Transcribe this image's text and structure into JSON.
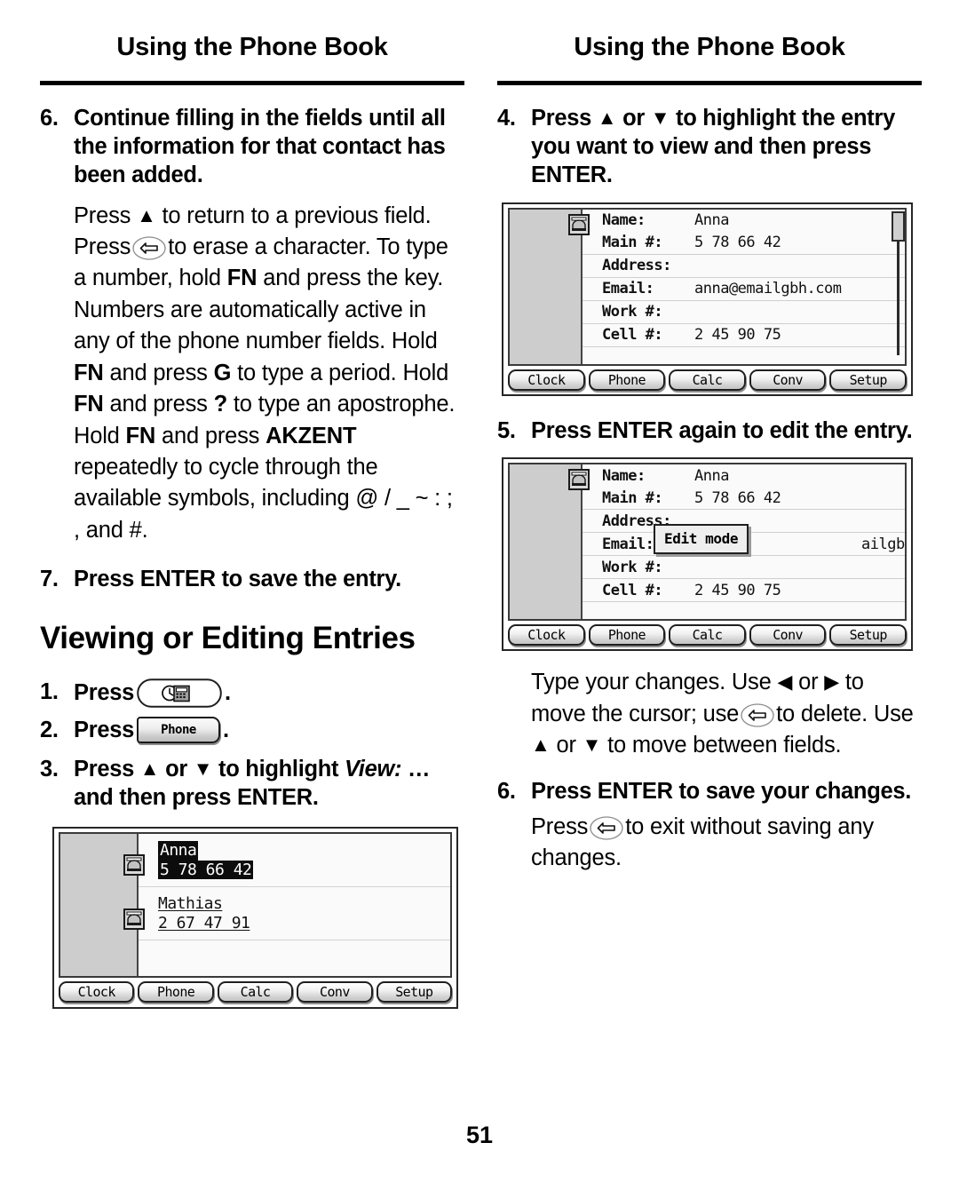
{
  "page": {
    "number": "51"
  },
  "left_column": {
    "running_head": "Using the Phone Book",
    "step6": {
      "num": "6.",
      "text": "Continue filling in the fields until all the information for that contact has been added."
    },
    "body1": {
      "p1": "Press",
      "p2": "to return to a previous field. Press",
      "p3": "to erase a character. To type a number, hold",
      "b_fn1": "FN",
      "p4": "and press the key. Numbers are automatically active in any of the phone number fields. Hold",
      "b_fn2": "FN",
      "p5": "and press",
      "b_g": "G",
      "p6": "to type a period. Hold",
      "b_fn3": "FN",
      "p7": "and press",
      "b_q": "?",
      "p8": "to type an apostrophe. Hold",
      "b_fn4": "FN",
      "p9": "and press",
      "b_akzent": "AKZENT",
      "p10": "repeatedly to cycle through the available symbols, including @ / _ ~ : ; , and #."
    },
    "step7": {
      "num": "7.",
      "text": "Press ENTER to save the entry."
    },
    "section_heading": "Viewing or Editing Entries",
    "step1": {
      "num": "1.",
      "label": "Press",
      "key": "organizer-key",
      "period": "."
    },
    "step2": {
      "num": "2.",
      "label": "Press",
      "key_label": "Phone",
      "period": "."
    },
    "step3": {
      "num": "3.",
      "pre": "Press",
      "or": "or",
      "mid": "to highlight",
      "italic": "View:",
      "post": "… and then press ENTER."
    },
    "lcd_list": {
      "rows": [
        {
          "name": "Anna",
          "number": "5 78 66 42",
          "state": "highlighted",
          "icon": "phone-icon"
        },
        {
          "name": "Mathias",
          "number": "2 67 47 91",
          "state": "underlined",
          "icon": "phone-icon"
        },
        {
          "name": "",
          "number": "",
          "state": "empty",
          "icon": ""
        }
      ],
      "tabs": [
        "Clock",
        "Phone",
        "Calc",
        "Conv",
        "Setup"
      ]
    }
  },
  "right_column": {
    "running_head": "Using the Phone Book",
    "step4": {
      "num": "4.",
      "pre": "Press",
      "or": "or",
      "post": "to highlight the entry you want to view and then press ENTER."
    },
    "lcd_view": {
      "fields": [
        {
          "label": "Name:",
          "value": "Anna"
        },
        {
          "label": "Main #:",
          "value": "5 78 66 42"
        },
        {
          "label": "Address:",
          "value": ""
        },
        {
          "label": "Email:",
          "value": "anna@emailgbh.com"
        },
        {
          "label": "Work #:",
          "value": ""
        },
        {
          "label": "Cell #:",
          "value": "2 45 90 75"
        }
      ],
      "icon": "phone-icon",
      "tabs": [
        "Clock",
        "Phone",
        "Calc",
        "Conv",
        "Setup"
      ]
    },
    "step5": {
      "num": "5.",
      "text": "Press ENTER again to edit the entry."
    },
    "lcd_edit": {
      "fields": [
        {
          "label": "Name:",
          "value": "Anna"
        },
        {
          "label": "Main #:",
          "value": "5 78 66 42"
        },
        {
          "label": "Address:",
          "value": ""
        },
        {
          "label": "Email:",
          "value": "ailgbh.com"
        },
        {
          "label": "Work #:",
          "value": ""
        },
        {
          "label": "Cell #:",
          "value": "2 45 90 75"
        }
      ],
      "tooltip": "Edit mode",
      "icon": "phone-icon",
      "tabs": [
        "Clock",
        "Phone",
        "Calc",
        "Conv",
        "Setup"
      ]
    },
    "body2": {
      "p1": "Type your changes. Use",
      "or1": "or",
      "p2": "to move the cursor; use",
      "p3": "to delete. Use",
      "or2": "or",
      "p4": "to move between fields."
    },
    "step6": {
      "num": "6.",
      "text": "Press ENTER to save your changes."
    },
    "body3": {
      "p1": "Press",
      "p2": "to exit without saving any changes."
    }
  },
  "glyphs": {
    "up": "▲",
    "down": "▼",
    "left": "◀",
    "right": "▶"
  }
}
